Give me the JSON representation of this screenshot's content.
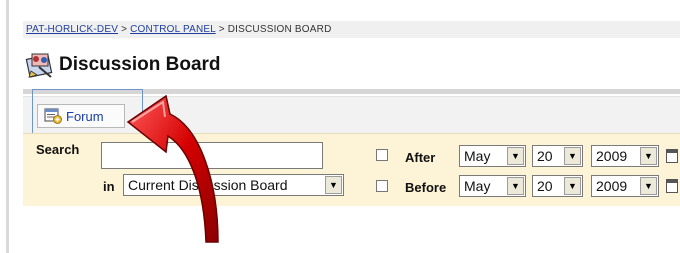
{
  "breadcrumb": {
    "items": [
      "PAT-HORLICK-DEV",
      "CONTROL PANEL",
      "DISCUSSION BOARD"
    ],
    "separator": ">"
  },
  "page": {
    "title": "Discussion Board",
    "icon": "discussion-board-icon"
  },
  "toolbar": {
    "forum_label": "Forum",
    "forum_icon": "add-forum-icon"
  },
  "search": {
    "label": "Search",
    "value": "",
    "in_label": "in",
    "scope_selected": "Current Discussion Board"
  },
  "date_filters": {
    "after": {
      "label": "After",
      "month": "May",
      "day": "20",
      "year": "2009",
      "checked": false
    },
    "before": {
      "label": "Before",
      "month": "May",
      "day": "20",
      "year": "2009",
      "checked": false
    }
  },
  "colors": {
    "link": "#1f3f9f",
    "panel": "#fdf3d6",
    "arrow": "#c40000",
    "highlight": "#6f96c9"
  }
}
